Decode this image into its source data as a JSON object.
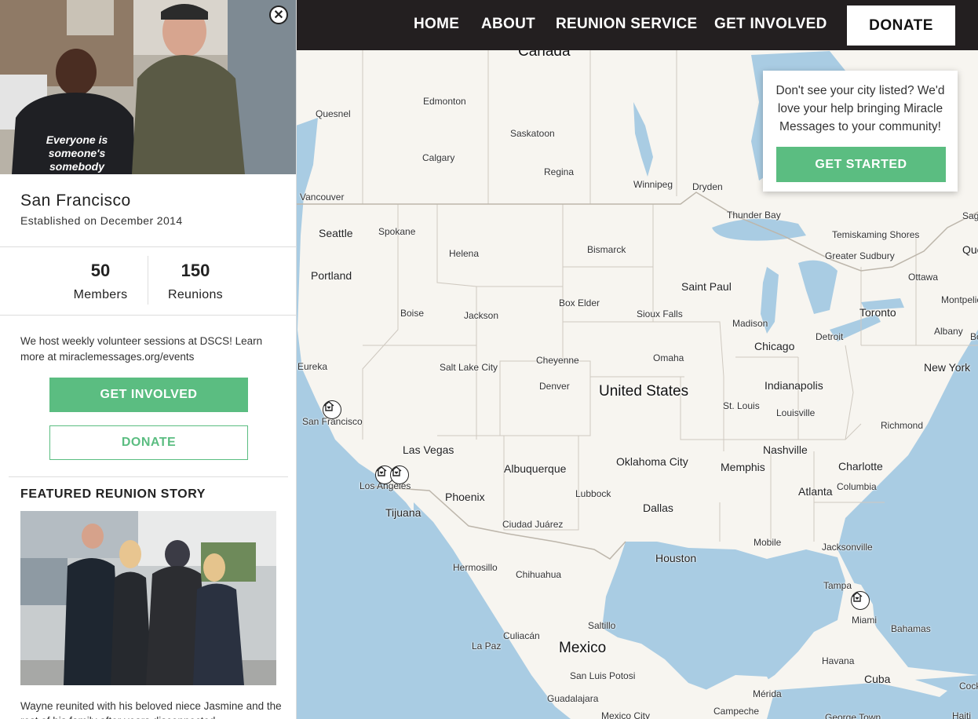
{
  "nav": {
    "links": [
      "HOME",
      "ABOUT",
      "REUNION SERVICE",
      "GET INVOLVED"
    ],
    "donate_label": "DONATE"
  },
  "popup": {
    "text": "Don't see your city listed? We'd love your help bringing Miracle Messages to your community!",
    "button_label": "GET STARTED"
  },
  "sidebar": {
    "hero_shirt_text": [
      "Everyone is",
      "someone's",
      "somebody"
    ],
    "city_name": "San Francisco",
    "established": "Established on December 2014",
    "stats": [
      {
        "value": "50",
        "label": "Members"
      },
      {
        "value": "150",
        "label": "Reunions"
      }
    ],
    "description": "We host weekly volunteer sessions at DSCS! Learn more at miraclemessages.org/events",
    "get_involved_label": "GET INVOLVED",
    "donate_label": "DONATE",
    "featured_title": "FEATURED REUNION STORY",
    "story_text": "Wayne reunited with his beloved niece Jasmine and the rest of his family after years disconnected"
  },
  "map": {
    "countries": [
      "Canada",
      "United States",
      "Mexico"
    ],
    "cities": [
      "Edmonton",
      "Quesnel",
      "Saskatoon",
      "Calgary",
      "Regina",
      "Winnipeg",
      "Dryden",
      "Vancouver",
      "Seattle",
      "Spokane",
      "Thunder Bay",
      "Sag",
      "Temiskaming Shores",
      "Que",
      "Helena",
      "Bismarck",
      "Greater Sudbury",
      "Portland",
      "Saint Paul",
      "Ottawa",
      "Montpelie",
      "Box Elder",
      "Boise",
      "Jackson",
      "Sioux Falls",
      "Toronto",
      "Madison",
      "Albany",
      "Bo",
      "Detroit",
      "Chicago",
      "Cheyenne",
      "Omaha",
      "New York",
      "Eureka",
      "Salt Lake City",
      "Denver",
      "Indianapolis",
      "St. Louis",
      "Louisville",
      "San Francisco",
      "Richmond",
      "Nashville",
      "Las Vegas",
      "Oklahoma City",
      "Albuquerque",
      "Memphis",
      "Charlotte",
      "Columbia",
      "Los Angeles",
      "Phoenix",
      "Lubbock",
      "Atlanta",
      "Tijuana",
      "Dallas",
      "Ciudad Juárez",
      "Mobile",
      "Jacksonville",
      "Hermosillo",
      "Houston",
      "Chihuahua",
      "Tampa",
      "Miami",
      "Saltillo",
      "Bahamas",
      "Culiacán",
      "La Paz",
      "Havana",
      "San Luis Potosi",
      "Cuba",
      "Guadalajara",
      "Cockbu",
      "Mérida",
      "Campeche",
      "Mexico City",
      "George Town",
      "Haiti"
    ]
  },
  "icons": {
    "close": "close-icon",
    "marker": "home-heart-icon"
  },
  "colors": {
    "accent_green": "#5bbd81",
    "nav_bg": "#231f20",
    "water": "#a9cce3",
    "land": "#f7f5f0"
  }
}
